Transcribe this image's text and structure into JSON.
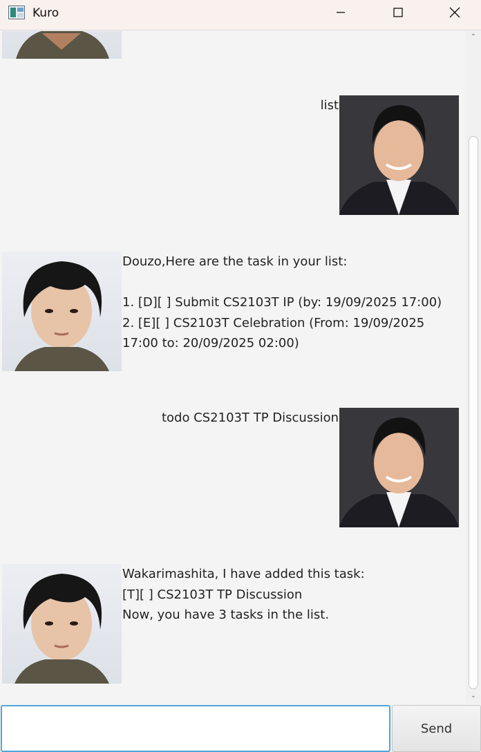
{
  "window": {
    "title": "Kuro"
  },
  "dialog": [
    {
      "speaker": "user",
      "text": "list"
    },
    {
      "speaker": "bot",
      "text": "Douzo,Here are the task in your list:\n\n1. [D][ ] Submit CS2103T IP (by: 19/09/2025 17:00)\n2. [E][ ] CS2103T Celebration (From: 19/09/2025\n17:00 to: 20/09/2025 02:00)"
    },
    {
      "speaker": "user",
      "text": "todo CS2103T TP Discussion"
    },
    {
      "speaker": "bot",
      "text": "Wakarimashita, I have added this task:\n[T][ ] CS2103T TP Discussion\nNow, you have 3 tasks in the list."
    }
  ],
  "input": {
    "placeholder": "",
    "value": ""
  },
  "send_label": "Send",
  "colors": {
    "titlebar": "#f9f1ee",
    "background": "#f4f4f4",
    "input_focus": "#4fa6d8"
  }
}
